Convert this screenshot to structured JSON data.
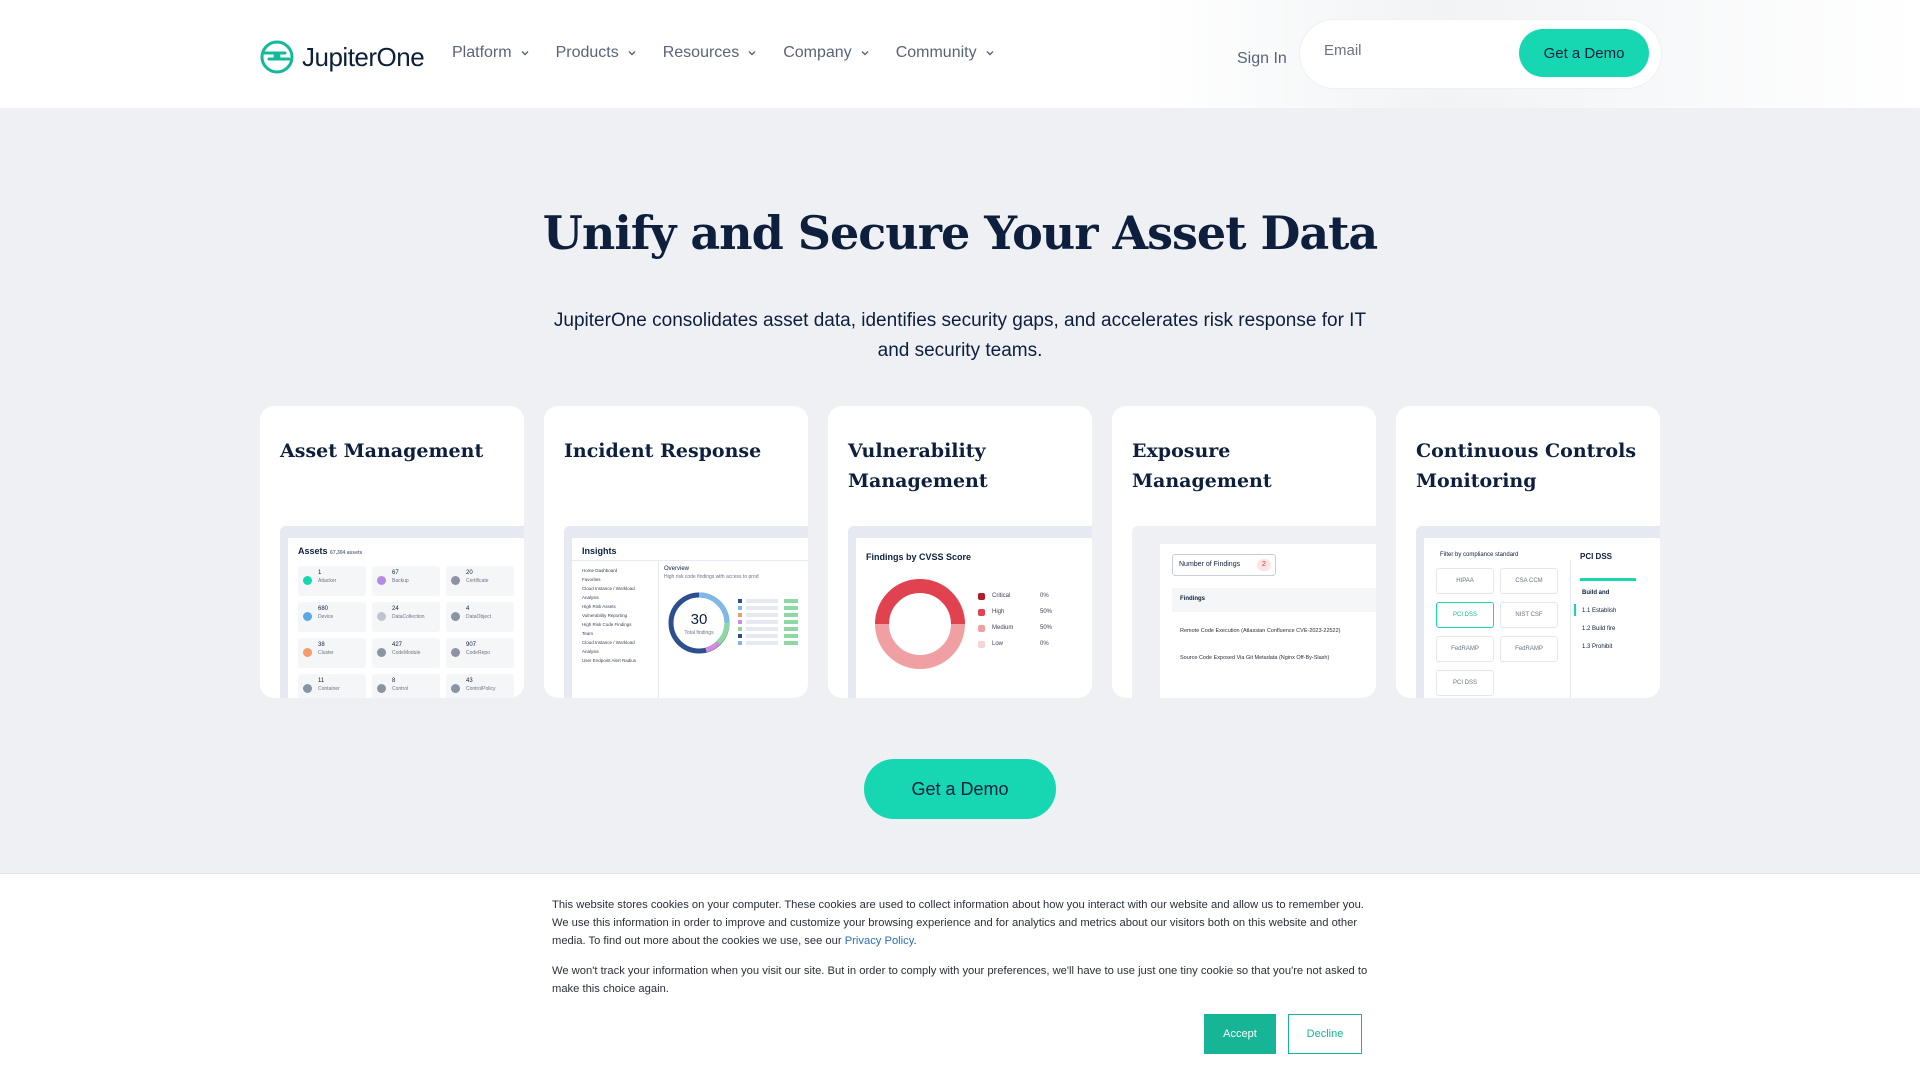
{
  "brand": {
    "name": "JupiterOne",
    "accent": "#17d6b2",
    "navy": "#0d1f3c"
  },
  "nav": {
    "items": [
      {
        "label": "Platform"
      },
      {
        "label": "Products"
      },
      {
        "label": "Resources"
      },
      {
        "label": "Company"
      },
      {
        "label": "Community"
      }
    ],
    "sign_in": "Sign In",
    "email_placeholder": "Email",
    "demo_label": "Get a Demo"
  },
  "hero": {
    "title": "Unify and Secure Your Asset Data",
    "subtitle": "JupiterOne consolidates asset data, identifies security gaps, and accelerates risk response for IT and security teams."
  },
  "cards": [
    {
      "title": "Asset Management",
      "preview_title": "Assets",
      "preview_count": "67,304 assets",
      "assets": [
        {
          "num": "1",
          "label": "Attacker",
          "color": "#17d6b2"
        },
        {
          "num": "67",
          "label": "Backup",
          "color": "#b58be6"
        },
        {
          "num": "20",
          "label": "Certificate",
          "color": "#8c93a3"
        },
        {
          "num": "680",
          "label": "Device",
          "color": "#5aa9e6"
        },
        {
          "num": "24",
          "label": "DataCollection",
          "color": "#c0c4cf"
        },
        {
          "num": "4",
          "label": "DataObject",
          "color": "#8c93a3"
        },
        {
          "num": "38",
          "label": "Cluster",
          "color": "#f59a6c"
        },
        {
          "num": "427",
          "label": "CodeModule",
          "color": "#8c93a3"
        },
        {
          "num": "907",
          "label": "CodeRepo",
          "color": "#8c93a3"
        },
        {
          "num": "11",
          "label": "Container",
          "color": "#8c93a3"
        },
        {
          "num": "8",
          "label": "Control",
          "color": "#8c93a3"
        },
        {
          "num": "43",
          "label": "ControlPolicy",
          "color": "#8c93a3"
        }
      ]
    },
    {
      "title": "Incident Response",
      "preview_title": "Insights",
      "sidebar": [
        "Home Dashboard",
        "Favorites",
        "Cloud Instance / Workload Analysis",
        "High Risk Assets",
        "Vulnerability Reporting",
        "High Risk Code Findings",
        "Team",
        "Cloud Instance / Workload Analysis",
        "User Endpoint Alert Radius"
      ],
      "overview_title": "Overview",
      "overview_sub": "High risk code findings with access to prod",
      "donut_value": "30",
      "donut_label": "Total findings"
    },
    {
      "title": "Vulnerability Management",
      "preview_title": "Findings by CVSS Score",
      "legend": [
        {
          "label": "Critical",
          "pct": "0%",
          "color": "#b01e2a"
        },
        {
          "label": "High",
          "pct": "50%",
          "color": "#e0424f"
        },
        {
          "label": "Medium",
          "pct": "50%",
          "color": "#f0a0a2"
        },
        {
          "label": "Low",
          "pct": "0%",
          "color": "#f7d3d4"
        }
      ]
    },
    {
      "title": "Exposure Management",
      "badge_label": "Number of Findings",
      "badge_count": "2",
      "findings_header": "Findings",
      "findings": [
        "Remote Code Execution (Atlassian Confluence CVE-2023-22522)",
        "Source Code Exposed Via Git Metadata (Nginx Off-By-Slash)"
      ]
    },
    {
      "title": "Continuous Controls Monitoring",
      "filter_label": "Filter by compliance standard",
      "standards": [
        "HIPAA",
        "CSA CCM",
        "PCI DSS",
        "NIST CSF",
        "FedRAMP",
        "FedRAMP",
        "PCI DSS"
      ],
      "panel_title": "PCI DSS",
      "panel_section": "Build and",
      "panel_items": [
        "1.1 Establish",
        "1.2 Build fire",
        "1.3 Prohibit"
      ]
    }
  ],
  "cta": {
    "label": "Get a Demo"
  },
  "cookie": {
    "text1": "This website stores cookies on your computer. These cookies are used to collect information about how you interact with our website and allow us to remember you. We use this information in order to improve and customize your browsing experience and for analytics and metrics about our visitors both on this website and other media. To find out more about the cookies we use, see our",
    "privacy_link": "Privacy Policy",
    "text2": "We won't track your information when you visit our site. But in order to comply with your preferences, we'll have to use just one tiny cookie so that you're not asked to make this choice again.",
    "accept": "Accept",
    "decline": "Decline"
  }
}
